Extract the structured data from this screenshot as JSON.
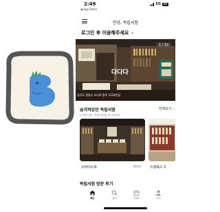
{
  "status_bar": {
    "time": "2:49",
    "back_label": "◀ App Store",
    "network": "5G",
    "battery": "83"
  },
  "header": {
    "menu_icon": "hamburger-icon",
    "title": "안녕, 독립서점"
  },
  "login_prompt": {
    "label": "로그인 후 이용해주세요",
    "chevron": "›"
  },
  "banner": {
    "title": "다다다",
    "counter": "1 / 10",
    "caption": "경기도 광명시 오리로 흥로 1234번길"
  },
  "section": {
    "title": "숨겨져있던 독립서점",
    "subtitle": "근처에 있는 독립서점을 만나보세요",
    "more_label": "전체보기 ›"
  },
  "cards": [
    {
      "name": "스타더스트",
      "distance": "661m"
    },
    {
      "name": "스월북스 3"
    }
  ],
  "review_section": {
    "title": "독립서점 방문 후기"
  },
  "tabbar": {
    "items": [
      {
        "label": "메인",
        "icon": "home-icon",
        "active": true
      },
      {
        "label": "검색",
        "icon": "search-icon",
        "active": false
      },
      {
        "label": "이벤트",
        "icon": "calendar-icon",
        "active": false
      },
      {
        "label": "마이",
        "icon": "person-icon",
        "active": false
      }
    ]
  },
  "colors": {
    "app_icon_blue": "#4a8fd8",
    "app_icon_accent": "#3fa84a",
    "app_icon_frame": "#555555",
    "app_icon_bg": "#f6f2e6",
    "banner_bg": "#4a3b2c",
    "active_tab": "#222222",
    "inactive_tab": "#888888"
  }
}
